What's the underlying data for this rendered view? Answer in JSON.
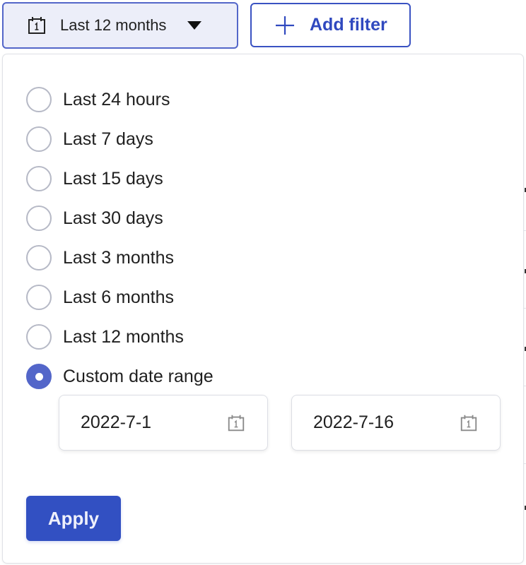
{
  "toolbar": {
    "date_range_label": "Last 12 months",
    "add_filter_label": "Add filter"
  },
  "dropdown": {
    "options": [
      {
        "label": "Last 24 hours",
        "selected": false
      },
      {
        "label": "Last 7 days",
        "selected": false
      },
      {
        "label": "Last 15 days",
        "selected": false
      },
      {
        "label": "Last 30 days",
        "selected": false
      },
      {
        "label": "Last 3 months",
        "selected": false
      },
      {
        "label": "Last 6 months",
        "selected": false
      },
      {
        "label": "Last 12 months",
        "selected": false
      },
      {
        "label": "Custom date range",
        "selected": true
      }
    ],
    "custom_range": {
      "start_date": "2022-7-1",
      "end_date": "2022-7-16",
      "calendar_icon_day": "1"
    },
    "apply_label": "Apply"
  },
  "icons": {
    "date_trigger": "calendar-icon",
    "caret": "caret-down-icon",
    "add_filter": "plus-icon",
    "date_input": "calendar-icon"
  },
  "colors": {
    "accent": "#3250c2",
    "trigger_bg": "#eceef9",
    "trigger_border": "#5366c9",
    "radio_checked": "#5366c9",
    "radio_unchecked_border": "#b6b9c6"
  }
}
